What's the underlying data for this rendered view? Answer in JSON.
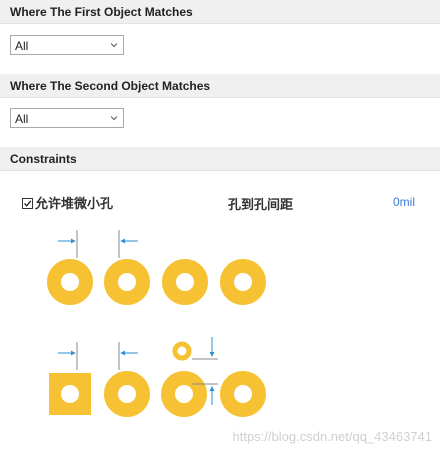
{
  "sections": {
    "first_object": {
      "title": "Where The First Object Matches",
      "select_value": "All"
    },
    "second_object": {
      "title": "Where The Second Object Matches",
      "select_value": "All"
    },
    "constraints": {
      "title": "Constraints"
    }
  },
  "constraints": {
    "allow_stacked_label": "允许堆微小孔",
    "allow_stacked_checked": true,
    "hole_to_hole_label": "孔到孔间距",
    "hole_to_hole_value": "0mil"
  },
  "colors": {
    "pad": "#f6c132",
    "dim_arrow": "#2f8fd0",
    "link": "#3a7bd5"
  },
  "watermark": "https://blog.csdn.net/qq_43463741"
}
